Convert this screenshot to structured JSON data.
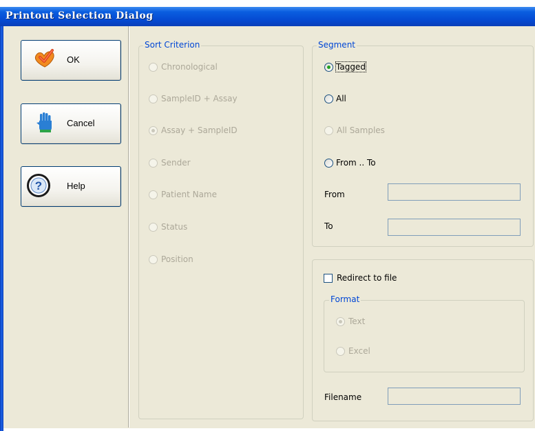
{
  "window": {
    "title": "Printout Selection Dialog"
  },
  "buttons": [
    {
      "id": "ok",
      "label": "OK",
      "icon": "checkmark-icon"
    },
    {
      "id": "cancel",
      "label": "Cancel",
      "icon": "stop-hand-icon"
    },
    {
      "id": "help",
      "label": "Help",
      "icon": "help-question-icon"
    }
  ],
  "sort": {
    "legend": "Sort Criterion",
    "options": [
      "Chronological",
      "SampleID + Assay",
      "Assay + SampleID",
      "Sender",
      "Patient Name",
      "Status",
      "Position"
    ],
    "selected": "Assay + SampleID",
    "enabled": false
  },
  "segment": {
    "legend": "Segment",
    "options": {
      "tagged": "Tagged",
      "all": "All",
      "all_samples": "All Samples",
      "from_to": "From .. To"
    },
    "selected": "Tagged",
    "from_label": "From",
    "to_label": "To",
    "from_value": "",
    "to_value": ""
  },
  "output": {
    "redirect_label": "Redirect to file",
    "redirect_checked": false,
    "format_legend": "Format",
    "format_options": {
      "text": "Text",
      "excel": "Excel"
    },
    "format_selected": "Text",
    "filename_label": "Filename",
    "filename_value": ""
  },
  "colors": {
    "title_bar": "#0549d1",
    "dialog_bg": "#ece9d8",
    "legend": "#0046d5",
    "disabled_text": "#aca899",
    "radio_dot": "#21a121"
  }
}
